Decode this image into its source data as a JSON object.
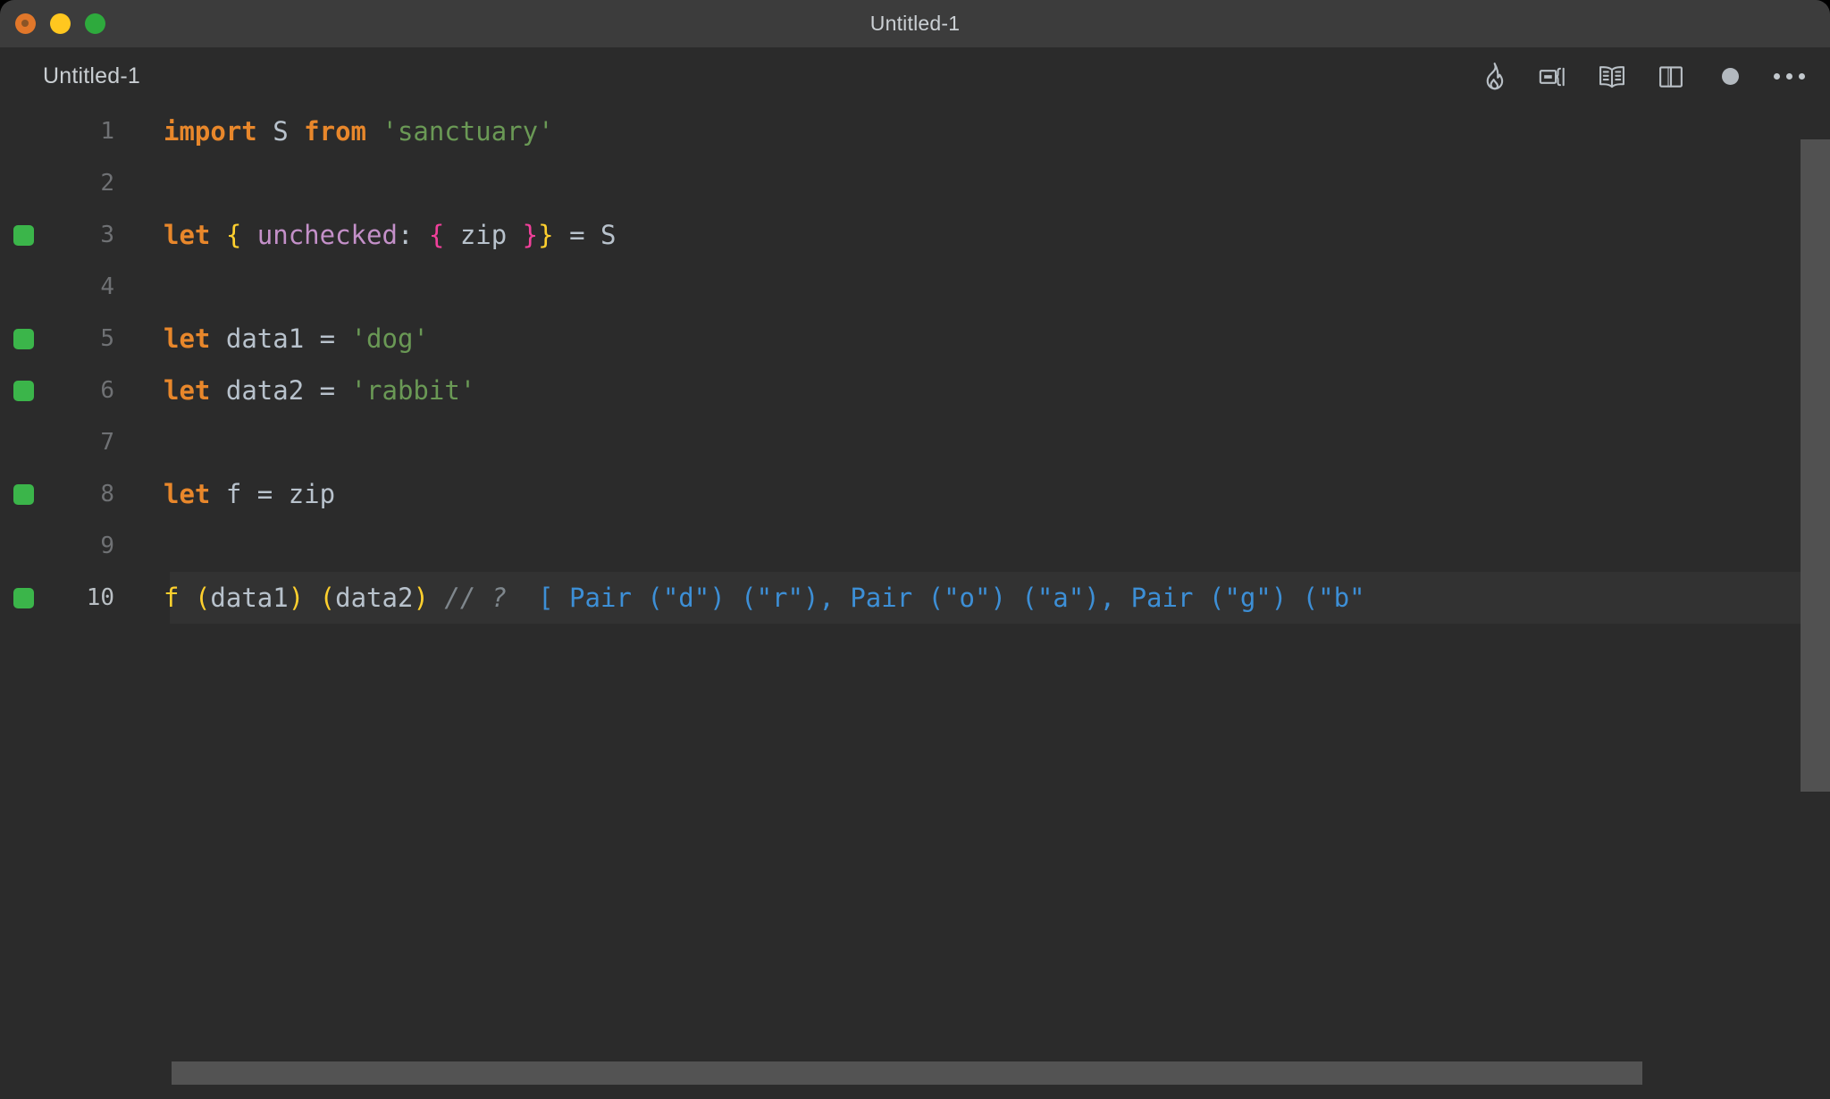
{
  "window": {
    "title": "Untitled-1",
    "traffic_lights": [
      {
        "name": "close",
        "color": "#e1772a"
      },
      {
        "name": "minimize",
        "color": "#ffc71f"
      },
      {
        "name": "maximize",
        "color": "#2eaa3d"
      }
    ]
  },
  "tab": {
    "label": "Untitled-1"
  },
  "toolbar": {
    "items": [
      {
        "icon": "flame-icon",
        "label": "Quokka"
      },
      {
        "icon": "run-code-icon",
        "label": "Run"
      },
      {
        "icon": "open-book-icon",
        "label": "Open Preview"
      },
      {
        "icon": "split-editor-icon",
        "label": "Split Editor"
      },
      {
        "icon": "circle-dot-icon",
        "label": "Unsaved"
      },
      {
        "icon": "ellipsis-icon",
        "label": "More Actions"
      }
    ]
  },
  "editor": {
    "language": "javascript",
    "active_line": 10,
    "colors": {
      "background": "#2b2b2b",
      "active_line": "#323232",
      "keyword": "#e8872b",
      "string": "#6a9955",
      "property": "#c490c9",
      "bracket_yellow": "#ffd02e",
      "bracket_magenta": "#f0409a",
      "function": "#ffd02e",
      "comment": "#7f878d",
      "quokka_output": "#3d8fd6",
      "marker_green": "#3bb54a",
      "text": "#b8c2cc",
      "line_number": "#6f7174",
      "line_number_active": "#b9bfc4"
    },
    "lines": [
      {
        "num": "1",
        "marker": false,
        "active": false,
        "tokens": [
          {
            "t": "import",
            "c": "kw"
          },
          {
            "t": " ",
            "c": "plain"
          },
          {
            "t": "S",
            "c": "plain"
          },
          {
            "t": " ",
            "c": "plain"
          },
          {
            "t": "from",
            "c": "kw"
          },
          {
            "t": " ",
            "c": "plain"
          },
          {
            "t": "'sanctuary'",
            "c": "str"
          }
        ]
      },
      {
        "num": "2",
        "marker": false,
        "active": false,
        "tokens": []
      },
      {
        "num": "3",
        "marker": true,
        "active": false,
        "tokens": [
          {
            "t": "let",
            "c": "kw"
          },
          {
            "t": " ",
            "c": "plain"
          },
          {
            "t": "{",
            "c": "br-y"
          },
          {
            "t": " ",
            "c": "plain"
          },
          {
            "t": "unchecked",
            "c": "prop"
          },
          {
            "t": ":",
            "c": "plain"
          },
          {
            "t": " ",
            "c": "plain"
          },
          {
            "t": "{",
            "c": "br-m"
          },
          {
            "t": " ",
            "c": "plain"
          },
          {
            "t": "zip",
            "c": "plain"
          },
          {
            "t": " ",
            "c": "plain"
          },
          {
            "t": "}",
            "c": "br-m"
          },
          {
            "t": "}",
            "c": "br-y"
          },
          {
            "t": " = ",
            "c": "plain"
          },
          {
            "t": "S",
            "c": "plain"
          }
        ]
      },
      {
        "num": "4",
        "marker": false,
        "active": false,
        "tokens": []
      },
      {
        "num": "5",
        "marker": true,
        "active": false,
        "tokens": [
          {
            "t": "let",
            "c": "kw"
          },
          {
            "t": " ",
            "c": "plain"
          },
          {
            "t": "data1",
            "c": "plain"
          },
          {
            "t": " = ",
            "c": "plain"
          },
          {
            "t": "'dog'",
            "c": "str"
          }
        ]
      },
      {
        "num": "6",
        "marker": true,
        "active": false,
        "tokens": [
          {
            "t": "let",
            "c": "kw"
          },
          {
            "t": " ",
            "c": "plain"
          },
          {
            "t": "data2",
            "c": "plain"
          },
          {
            "t": " = ",
            "c": "plain"
          },
          {
            "t": "'rabbit'",
            "c": "str"
          }
        ]
      },
      {
        "num": "7",
        "marker": false,
        "active": false,
        "tokens": []
      },
      {
        "num": "8",
        "marker": true,
        "active": false,
        "tokens": [
          {
            "t": "let",
            "c": "kw"
          },
          {
            "t": " ",
            "c": "plain"
          },
          {
            "t": "f",
            "c": "plain"
          },
          {
            "t": " = ",
            "c": "plain"
          },
          {
            "t": "zip",
            "c": "plain"
          }
        ]
      },
      {
        "num": "9",
        "marker": false,
        "active": false,
        "tokens": []
      },
      {
        "num": "10",
        "marker": true,
        "active": true,
        "tokens": [
          {
            "t": "f",
            "c": "fn"
          },
          {
            "t": " ",
            "c": "plain"
          },
          {
            "t": "(",
            "c": "br-y"
          },
          {
            "t": "data1",
            "c": "plain"
          },
          {
            "t": ")",
            "c": "br-y"
          },
          {
            "t": " ",
            "c": "plain"
          },
          {
            "t": "(",
            "c": "br-y"
          },
          {
            "t": "data2",
            "c": "plain"
          },
          {
            "t": ")",
            "c": "br-y"
          },
          {
            "t": " ",
            "c": "plain"
          },
          {
            "t": "// ?",
            "c": "comment"
          },
          {
            "t": "  ",
            "c": "plain"
          },
          {
            "t": "[ Pair (\"d\") (\"r\"), Pair (\"o\") (\"a\"), Pair (\"g\") (\"b\"",
            "c": "quokka"
          }
        ]
      }
    ]
  },
  "scrollbars": {
    "vertical_visible": true,
    "horizontal_visible": true
  }
}
